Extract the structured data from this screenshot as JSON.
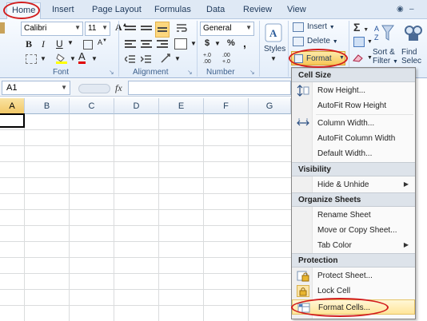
{
  "tabs": [
    {
      "label": "Home"
    },
    {
      "label": "Insert"
    },
    {
      "label": "Page Layout"
    },
    {
      "label": "Formulas"
    },
    {
      "label": "Data"
    },
    {
      "label": "Review"
    },
    {
      "label": "View"
    }
  ],
  "ribbon": {
    "font_name": "Calibri",
    "font_size": "11",
    "number_format": "General",
    "bold": "B",
    "italic": "I",
    "underline": "U",
    "grow_font": "A",
    "shrink_font": "A",
    "font_color_glyph": "A",
    "currency": "$",
    "percent": "%",
    "comma": ",",
    "inc_decimal": "+.0\n.00",
    "dec_decimal": ".00\n+.0",
    "groups": {
      "font": "Font",
      "alignment": "Alignment",
      "number": "Number"
    },
    "styles_label": "Styles",
    "cells": {
      "insert": "Insert",
      "delete": "Delete",
      "format": "Format"
    },
    "editing": {
      "sigma": "Σ",
      "sort_filter_1": "Sort &",
      "sort_filter_2": "Filter",
      "find_1": "Find",
      "find_2": "Selec"
    }
  },
  "formula_bar": {
    "name_box": "A1",
    "fx": "fx"
  },
  "columns": [
    "A",
    "B",
    "C",
    "D",
    "E",
    "F",
    "G"
  ],
  "colors": {
    "highlight_ellipse": "#d21d1d",
    "selected_header": "#f2c867",
    "menu_hover": "#ffe69a"
  },
  "menu": {
    "sections": {
      "cell_size": "Cell Size",
      "visibility": "Visibility",
      "organize": "Organize Sheets",
      "protection": "Protection"
    },
    "items": {
      "row_height": "Row Height...",
      "autofit_row": "AutoFit Row Height",
      "column_width": "Column Width...",
      "autofit_column": "AutoFit Column Width",
      "default_width": "Default Width...",
      "hide_unhide": "Hide & Unhide",
      "rename_sheet": "Rename Sheet",
      "move_copy": "Move or Copy Sheet...",
      "tab_color": "Tab Color",
      "protect_sheet": "Protect Sheet...",
      "lock_cell": "Lock Cell",
      "format_cells": "Format Cells..."
    },
    "icons": {
      "row_height": "row-height-icon",
      "column_width": "column-width-icon",
      "protect_sheet": "protect-sheet-icon",
      "lock_cell": "lock-icon",
      "format_cells": "format-cells-icon"
    }
  }
}
